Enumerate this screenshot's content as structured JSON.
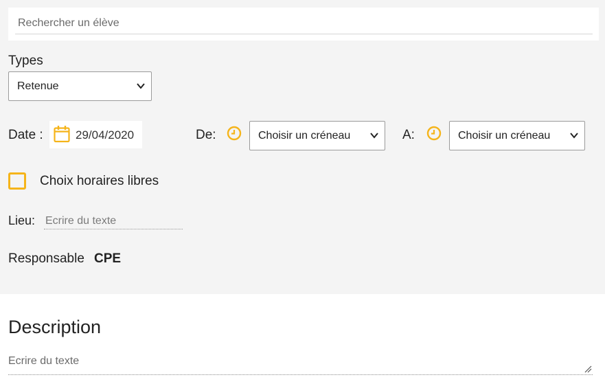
{
  "search": {
    "placeholder": "Rechercher un élève"
  },
  "types": {
    "label": "Types",
    "selected": "Retenue"
  },
  "date": {
    "label": "Date :",
    "value": "29/04/2020"
  },
  "de": {
    "label": "De:",
    "selected": "Choisir un créneau"
  },
  "a": {
    "label": "A:",
    "selected": "Choisir un créneau"
  },
  "free_hours": {
    "label": "Choix horaires libres",
    "checked": false
  },
  "lieu": {
    "label": "Lieu:",
    "placeholder": "Ecrire du texte"
  },
  "responsable": {
    "label": "Responsable",
    "value": "CPE"
  },
  "description": {
    "title": "Description",
    "placeholder": "Ecrire du texte"
  },
  "colors": {
    "accent": "#f5b41a",
    "panel": "#f4f4f4"
  },
  "icons": {
    "date": "calendar-icon",
    "time": "clock-icon",
    "dropdown": "chevron-down-icon"
  }
}
